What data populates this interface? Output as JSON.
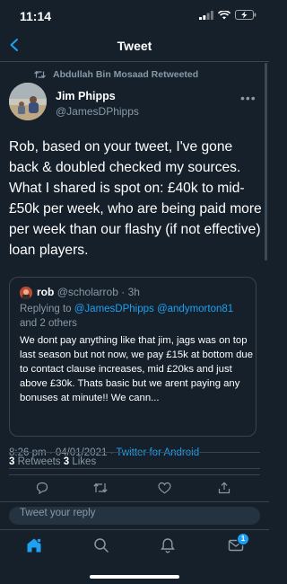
{
  "status_bar": {
    "time": "11:14"
  },
  "header": {
    "title": "Tweet"
  },
  "retweet": {
    "text": "Abdullah Bin Mosaad Retweeted"
  },
  "author": {
    "name": "Jim Phipps",
    "handle": "@JamesDPhipps"
  },
  "tweet": {
    "body": "Rob, based on your tweet, I've gone back & doubled checked my sources. What I shared is spot on: £40k to mid-£50k per week, who are being paid more per week than our flashy (if not effective) loan players."
  },
  "quote": {
    "name": "rob",
    "handle": "@scholarrob",
    "sep": "·",
    "age": "3h",
    "replying_prefix": "Replying to",
    "replying_users": "@JamesDPhipps @andymorton81",
    "replying_suffix": "and 2 others",
    "body": "We dont pay anything like that jim, jags was on top last season but not now, we pay £15k at bottom due to contact clause increases, mid £20ks and just above £30k. Thats basic but we arent paying any bonuses at minute!! We cann..."
  },
  "meta": {
    "time": "8:26 pm",
    "sep1": "·",
    "date": "04/01/2021",
    "sep2": "·",
    "source": "Twitter for Android"
  },
  "stats": {
    "retweets_count": "3",
    "retweets_label": "Retweets",
    "likes_count": "3",
    "likes_label": "Likes"
  },
  "reply": {
    "placeholder": "Tweet your reply"
  },
  "tabbar": {
    "notifications_badge": "1"
  },
  "colors": {
    "background": "#15202b",
    "accent": "#1da1f2",
    "muted": "#8899a6",
    "divider": "#38444d"
  },
  "icons": [
    "back-arrow-icon",
    "retweet-icon",
    "more-icon",
    "reply-icon",
    "like-icon",
    "share-icon",
    "home-icon",
    "search-icon",
    "bell-icon",
    "mail-icon",
    "signal-icon",
    "wifi-icon",
    "battery-icon"
  ]
}
